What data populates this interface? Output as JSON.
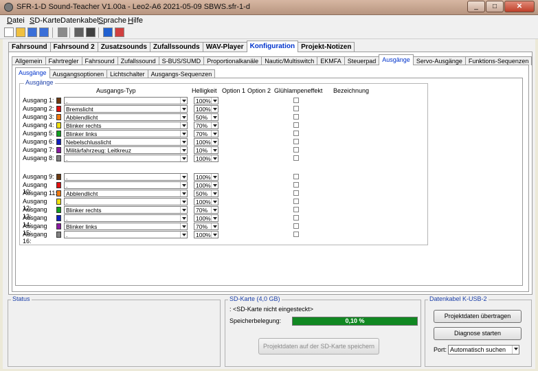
{
  "window": {
    "title": "SFR-1-D Sound-Teacher V1.00a - Leo2-A6 2021-05-09 SBWS.sfr-1-d",
    "minimize": "_",
    "maximize": "□",
    "close": "✕"
  },
  "menu": {
    "items": [
      {
        "u": "D",
        "rest": "atei"
      },
      {
        "u": "S",
        "rest": "D-Karte"
      },
      {
        "u": "",
        "rest": "Datenkabel"
      },
      {
        "u": "S",
        "rest": "prache"
      },
      {
        "u": "H",
        "rest": "ilfe"
      }
    ]
  },
  "toolbar": {
    "icons": [
      "new-icon",
      "open-icon",
      "save-icon",
      "save-as-icon",
      "print-icon",
      "sd-card-icon",
      "cable-icon",
      "music-note-icon",
      "document-icon"
    ]
  },
  "main_tabs": [
    "Fahrsound",
    "Fahrsound 2",
    "Zusatzsounds",
    "Zufallssounds",
    "WAV-Player",
    "Konfiguration",
    "Projekt-Notizen"
  ],
  "main_tab_active": 5,
  "config_tabs": [
    "Allgemein",
    "Fahrtregler",
    "Fahrsound",
    "Zufallssound",
    "S-BUS/SUMD",
    "Proportionalkanäle",
    "Nautic/Multiswitch",
    "EKMFA",
    "Steuerpad",
    "Ausgänge",
    "Servo-Ausgänge",
    "Funktions-Sequenzen"
  ],
  "config_tab_active": 9,
  "output_tabs": [
    "Ausgänge",
    "Ausgangsoptionen",
    "Lichtschalter",
    "Ausgangs-Sequenzen"
  ],
  "output_tab_active": 0,
  "outputs_group": {
    "label": "Ausgänge",
    "headers": {
      "type": "Ausgangs-Typ",
      "brightness": "Helligkeit",
      "option1": "Option 1",
      "option2": "Option 2",
      "glow": "Glühlampeneffekt",
      "name": "Bezeichnung"
    },
    "rows": [
      {
        "label": "Ausgang 1:",
        "color": "#6b3a12",
        "type": ".",
        "brightness": "100%",
        "glow": false
      },
      {
        "label": "Ausgang 2:",
        "color": "#e01010",
        "type": "Bremslicht",
        "brightness": "100%",
        "glow": false
      },
      {
        "label": "Ausgang 3:",
        "color": "#f07a10",
        "type": "Abblendlicht",
        "brightness": "50%",
        "glow": false
      },
      {
        "label": "Ausgang 4:",
        "color": "#f0e010",
        "type": "Blinker rechts",
        "brightness": "70%",
        "glow": false
      },
      {
        "label": "Ausgang 5:",
        "color": "#10a020",
        "type": "Blinker links",
        "brightness": "70%",
        "glow": false
      },
      {
        "label": "Ausgang 6:",
        "color": "#1020c0",
        "type": "Nebelschlusslicht",
        "brightness": "100%",
        "glow": false
      },
      {
        "label": "Ausgang 7:",
        "color": "#8a1aa0",
        "type": "Militärfahrzeug: Leitkreuz",
        "brightness": "10%",
        "glow": false
      },
      {
        "label": "Ausgang 8:",
        "color": "#808080",
        "type": ".",
        "brightness": "100%",
        "glow": false
      },
      {
        "label": "Ausgang 9:",
        "color": "#6b3a12",
        "type": ".",
        "brightness": "100%",
        "glow": false
      },
      {
        "label": "Ausgang 10:",
        "color": "#e01010",
        "type": ".",
        "brightness": "100%",
        "glow": false
      },
      {
        "label": "Ausgang 11:",
        "color": "#f07a10",
        "type": "Abblendlicht",
        "brightness": "50%",
        "glow": false
      },
      {
        "label": "Ausgang 12:",
        "color": "#f0e010",
        "type": ".",
        "brightness": "100%",
        "glow": false
      },
      {
        "label": "Ausgang 13:",
        "color": "#10a020",
        "type": "Blinker rechts",
        "brightness": "70%",
        "glow": false
      },
      {
        "label": "Ausgang 14:",
        "color": "#1020c0",
        "type": ".",
        "brightness": "100%",
        "glow": false
      },
      {
        "label": "Ausgang 15:",
        "color": "#8a1aa0",
        "type": "Blinker links",
        "brightness": "70%",
        "glow": false
      },
      {
        "label": "Ausgang 16:",
        "color": "#808080",
        "type": ".",
        "brightness": "100%",
        "glow": false
      }
    ]
  },
  "status": {
    "label": "Status"
  },
  "sd_card": {
    "label": "SD-Karte (4,0 GB)",
    "status_text": ": <SD-Karte nicht eingesteckt>",
    "usage_label": "Speicherbelegung:",
    "usage_value": "0,10 %",
    "usage_fraction": 1.0,
    "save_button": "Projektdaten auf der SD-Karte speichern"
  },
  "cable": {
    "label": "Datenkabel K-USB-2",
    "transfer_button": "Projektdaten übertragen",
    "diagnose_button": "Diagnose starten",
    "port_label": "Port:",
    "port_value": "Automatisch suchen"
  }
}
